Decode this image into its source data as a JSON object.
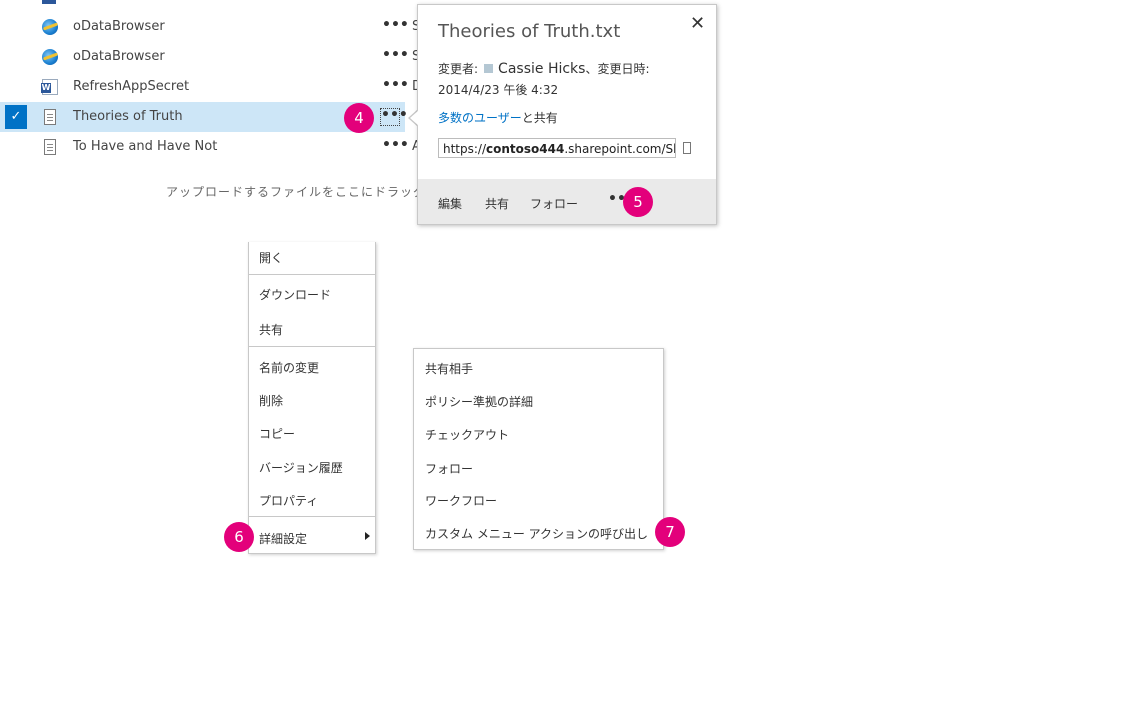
{
  "file_list": {
    "rows": [
      {
        "name": "oDataBrowser",
        "icon": "ie-icon",
        "trail": "S"
      },
      {
        "name": "oDataBrowser",
        "icon": "ie-icon",
        "trail": "S"
      },
      {
        "name": "RefreshAppSecret",
        "icon": "word-icon",
        "trail": "D"
      },
      {
        "name": "Theories of Truth",
        "icon": "document-icon",
        "trail": ""
      },
      {
        "name": "To Have and Have Not",
        "icon": "document-icon",
        "trail": "A"
      }
    ],
    "more_glyph": "•••",
    "selected_check": "✓",
    "drop_hint": "アップロードするファイルをここにドラッグ"
  },
  "callouts": {
    "c4": "4",
    "c5": "5",
    "c6": "6",
    "c7": "7"
  },
  "card": {
    "title": "Theories of Truth.txt",
    "close": "✕",
    "modified_by_label": "変更者:",
    "modified_by_user": "Cassie Hicks",
    "modified_date_label": "、変更日時:",
    "modified_date": "2014/4/23 午後 4:32",
    "shared_link": "多数のユーザー",
    "shared_suffix": "と共有",
    "url_prefix": "https://",
    "url_bold": "contoso444",
    "url_rest": ".sharepoint.com/Sha",
    "footer": {
      "edit": "編集",
      "share": "共有",
      "follow": "フォロー",
      "more": "•••"
    }
  },
  "context_menu": {
    "open": "開く",
    "download": "ダウンロード",
    "share": "共有",
    "rename": "名前の変更",
    "delete": "削除",
    "copy": "コピー",
    "version_history": "バージョン履歴",
    "properties": "プロパティ",
    "advanced": "詳細設定"
  },
  "submenu": {
    "shared_with": "共有相手",
    "policy_details": "ポリシー準拠の詳細",
    "checkout": "チェックアウト",
    "follow": "フォロー",
    "workflow": "ワークフロー",
    "custom_action": "カスタム メニュー アクションの呼び出し"
  },
  "colors": {
    "accent": "#e3007b",
    "selected_row": "#cde6f7",
    "link": "#0072c6"
  }
}
